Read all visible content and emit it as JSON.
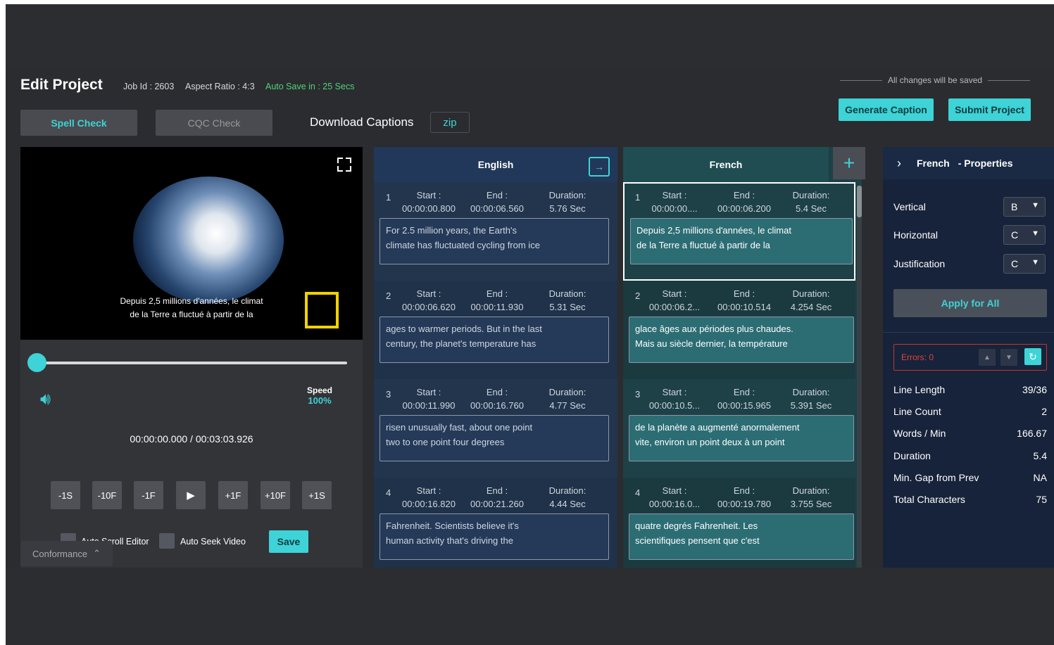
{
  "header": {
    "title": "Edit Project",
    "job_id": "Job Id : 2603",
    "aspect_ratio": "Aspect Ratio : 4:3",
    "auto_save": "Auto Save in : 25 Secs",
    "save_note": "All changes will be saved"
  },
  "toolbar": {
    "spell_check": "Spell Check",
    "cqc_check": "CQC Check",
    "download_captions": "Download Captions",
    "download_format": "zip",
    "generate_caption": "Generate Caption",
    "submit_project": "Submit Project"
  },
  "player": {
    "subtitle_line1": "Depuis 2,5 millions d'années, le climat",
    "subtitle_line2": "de la Terre a fluctué à partir de la",
    "speed_label": "Speed",
    "speed_value": "100%",
    "progress": 0,
    "timecode": "00:00:00.000 / 00:03:03.926",
    "controls": [
      "-1S",
      "-10F",
      "-1F",
      "▶",
      "+1F",
      "+10F",
      "+1S"
    ],
    "auto_scroll_label": "Auto Scroll Editor",
    "auto_seek_label": "Auto Seek Video",
    "save_label": "Save",
    "conformance_label": "Conformance"
  },
  "english": {
    "header": "English",
    "captions": [
      {
        "num": "1",
        "start_label": "Start :",
        "start": "00:00:00.800",
        "end_label": "End :",
        "end": "00:00:06.560",
        "dur_label": "Duration:",
        "dur": "5.76 Sec",
        "line1": "For 2.5 million years, the Earth's",
        "line2": "climate has fluctuated cycling from ice"
      },
      {
        "num": "2",
        "start_label": "Start :",
        "start": "00:00:06.620",
        "end_label": "End :",
        "end": "00:00:11.930",
        "dur_label": "Duration:",
        "dur": "5.31 Sec",
        "line1": "ages to warmer periods. But in the last",
        "line2": "century, the planet's temperature has"
      },
      {
        "num": "3",
        "start_label": "Start :",
        "start": "00:00:11.990",
        "end_label": "End :",
        "end": "00:00:16.760",
        "dur_label": "Duration:",
        "dur": "4.77 Sec",
        "line1": "risen unusually fast, about one point",
        "line2": "two to one point four degrees"
      },
      {
        "num": "4",
        "start_label": "Start :",
        "start": "00:00:16.820",
        "end_label": "End :",
        "end": "00:00:21.260",
        "dur_label": "Duration:",
        "dur": "4.44 Sec",
        "line1": "Fahrenheit. Scientists believe it's",
        "line2": "human activity that's driving the"
      }
    ]
  },
  "french": {
    "header": "French",
    "captions": [
      {
        "num": "1",
        "start_label": "Start :",
        "start": "00:00:00....",
        "end_label": "End :",
        "end": "00:00:06.200",
        "dur_label": "Duration:",
        "dur": "5.4 Sec",
        "line1": "Depuis 2,5 millions d'années, le climat",
        "line2": "de la Terre a fluctué à partir de la"
      },
      {
        "num": "2",
        "start_label": "Start :",
        "start": "00:00:06.2...",
        "end_label": "End :",
        "end": "00:00:10.514",
        "dur_label": "Duration:",
        "dur": "4.254 Sec",
        "line1": "glace âges aux périodes plus chaudes.",
        "line2": "Mais au siècle dernier, la température"
      },
      {
        "num": "3",
        "start_label": "Start :",
        "start": "00:00:10.5...",
        "end_label": "End :",
        "end": "00:00:15.965",
        "dur_label": "Duration:",
        "dur": "5.391 Sec",
        "line1": "de la planète a augmenté anormalement",
        "line2": "vite, environ un point deux à un point"
      },
      {
        "num": "4",
        "start_label": "Start :",
        "start": "00:00:16.0...",
        "end_label": "End :",
        "end": "00:00:19.780",
        "dur_label": "Duration:",
        "dur": "3.755 Sec",
        "line1": "quatre degrés Fahrenheit. Les",
        "line2": "scientifiques pensent que c'est"
      }
    ]
  },
  "properties": {
    "language": "French",
    "title": "- Properties",
    "vertical_label": "Vertical",
    "vertical_value": "B",
    "horizontal_label": "Horizontal",
    "horizontal_value": "C",
    "justification_label": "Justification",
    "justification_value": "C",
    "apply_all": "Apply for All",
    "errors": "Errors: 0",
    "stats": [
      {
        "label": "Line Length",
        "value": "39/36"
      },
      {
        "label": "Line Count",
        "value": "2"
      },
      {
        "label": "Words / Min",
        "value": "166.67"
      },
      {
        "label": "Duration",
        "value": "5.4"
      },
      {
        "label": "Min. Gap from Prev",
        "value": "NA"
      },
      {
        "label": "Total Characters",
        "value": "75"
      }
    ]
  },
  "colors": {
    "accent": "#3ed3d6",
    "background": "#2b2c30",
    "english_panel": "#22354d",
    "french_panel": "#1d4147",
    "error": "#e0453a"
  }
}
